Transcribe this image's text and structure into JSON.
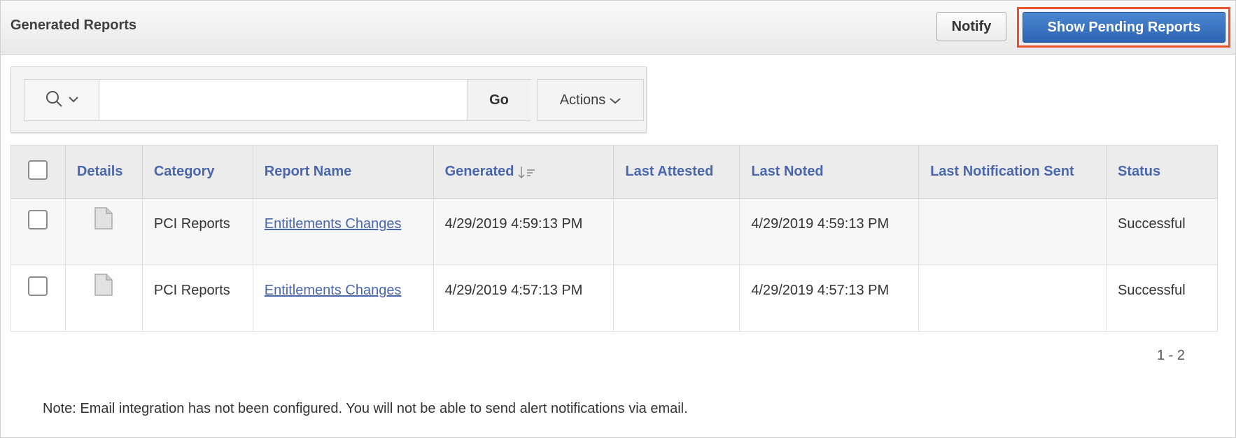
{
  "region": {
    "title": "Generated Reports",
    "notify_label": "Notify",
    "pending_label": "Show Pending Reports"
  },
  "toolbar": {
    "search_value": "",
    "go_label": "Go",
    "actions_label": "Actions"
  },
  "table": {
    "headers": {
      "details": "Details",
      "category": "Category",
      "report_name": "Report Name",
      "generated": "Generated",
      "last_attested": "Last Attested",
      "last_noted": "Last Noted",
      "last_notification_sent": "Last Notification Sent",
      "status": "Status"
    },
    "rows": [
      {
        "category": "PCI Reports",
        "report_name": "Entitlements Changes",
        "generated": "4/29/2019 4:59:13 PM",
        "last_attested": "",
        "last_noted": "4/29/2019 4:59:13 PM",
        "last_notification_sent": "",
        "status": "Successful"
      },
      {
        "category": "PCI Reports",
        "report_name": "Entitlements Changes",
        "generated": "4/29/2019 4:57:13 PM",
        "last_attested": "",
        "last_noted": "4/29/2019 4:57:13 PM",
        "last_notification_sent": "",
        "status": "Successful"
      }
    ]
  },
  "pagination": "1 - 2",
  "note": "Note: Email integration has not been configured. You will not be able to send alert notifications via email.",
  "colors": {
    "accent": "#2c63b3",
    "link": "#4a67ad",
    "highlight": "#e8532f"
  }
}
